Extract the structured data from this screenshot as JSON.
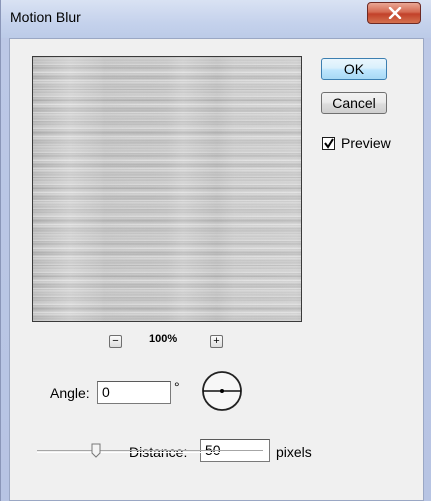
{
  "window": {
    "title": "Motion Blur"
  },
  "buttons": {
    "ok": "OK",
    "cancel": "Cancel"
  },
  "preview_checkbox": {
    "label": "Preview",
    "checked": true
  },
  "zoom": {
    "level": "100%",
    "minus": "−",
    "plus": "+"
  },
  "angle": {
    "label": "Angle:",
    "value": "0",
    "unit": "°"
  },
  "distance": {
    "label": "Distance:",
    "value": "50",
    "unit": "pixels"
  },
  "slider": {
    "value_fraction": 0.25
  },
  "colors": {
    "ok_accent": "#3c7fb1",
    "close_red": "#c2412a"
  },
  "icons": {
    "close": "close-icon",
    "check": "checkmark-icon",
    "dial": "angle-dial-icon"
  }
}
